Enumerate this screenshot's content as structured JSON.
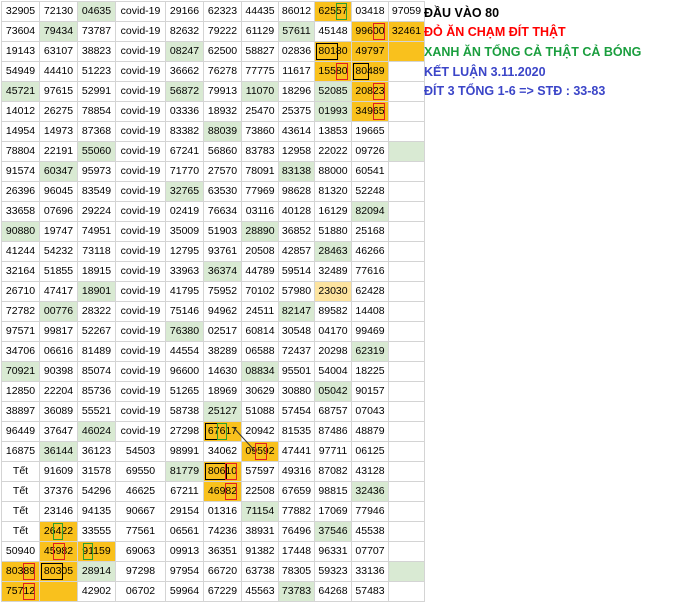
{
  "rows": [
    [
      "32905",
      "72130",
      "04635",
      "covid-19",
      "29166",
      "62323",
      "44435",
      "86012",
      "62557",
      "03418",
      "97059"
    ],
    [
      "73604",
      "79434",
      "73787",
      "covid-19",
      "82632",
      "79222",
      "61129",
      "57611",
      "45148",
      "99600",
      "32461"
    ],
    [
      "19143",
      "63107",
      "38823",
      "covid-19",
      "08247",
      "62500",
      "58827",
      "02836",
      "80180",
      "49797",
      ""
    ],
    [
      "54949",
      "44410",
      "51223",
      "covid-19",
      "36662",
      "76278",
      "77775",
      "11617",
      "15580",
      "80489",
      ""
    ],
    [
      "45721",
      "97615",
      "52991",
      "covid-19",
      "56872",
      "79913",
      "11070",
      "18296",
      "52085",
      "20823",
      ""
    ],
    [
      "14012",
      "26275",
      "78854",
      "covid-19",
      "03336",
      "18932",
      "25470",
      "25375",
      "01993",
      "34965",
      ""
    ],
    [
      "14954",
      "14973",
      "87368",
      "covid-19",
      "83382",
      "88039",
      "73860",
      "43614",
      "13853",
      "19665",
      ""
    ],
    [
      "78804",
      "22191",
      "55060",
      "covid-19",
      "67241",
      "56860",
      "83783",
      "12958",
      "22022",
      "09726",
      ""
    ],
    [
      "91574",
      "60347",
      "95973",
      "covid-19",
      "71770",
      "27570",
      "78091",
      "83138",
      "88000",
      "60541",
      ""
    ],
    [
      "26396",
      "96045",
      "83549",
      "covid-19",
      "32765",
      "63530",
      "77969",
      "98628",
      "81320",
      "52248",
      ""
    ],
    [
      "33658",
      "07696",
      "29224",
      "covid-19",
      "02419",
      "76634",
      "03116",
      "40128",
      "16129",
      "82094",
      ""
    ],
    [
      "90880",
      "19747",
      "74951",
      "covid-19",
      "35009",
      "51903",
      "28890",
      "36852",
      "51880",
      "25168",
      ""
    ],
    [
      "41244",
      "54232",
      "73118",
      "covid-19",
      "12795",
      "93761",
      "20508",
      "42857",
      "28463",
      "46266",
      ""
    ],
    [
      "32164",
      "51855",
      "18915",
      "covid-19",
      "33963",
      "36374",
      "44789",
      "59514",
      "32489",
      "77616",
      ""
    ],
    [
      "26710",
      "47417",
      "18901",
      "covid-19",
      "41795",
      "75952",
      "70102",
      "57980",
      "23030",
      "62428",
      ""
    ],
    [
      "72782",
      "00776",
      "28322",
      "covid-19",
      "75146",
      "94962",
      "24511",
      "82147",
      "89582",
      "14408",
      ""
    ],
    [
      "97571",
      "99817",
      "52267",
      "covid-19",
      "76380",
      "02517",
      "60814",
      "30548",
      "04170",
      "99469",
      ""
    ],
    [
      "34706",
      "06616",
      "81489",
      "covid-19",
      "44554",
      "38289",
      "06588",
      "72437",
      "20298",
      "62319",
      ""
    ],
    [
      "70921",
      "90398",
      "85074",
      "covid-19",
      "96600",
      "14630",
      "08834",
      "95501",
      "54004",
      "18225",
      ""
    ],
    [
      "12850",
      "22204",
      "85736",
      "covid-19",
      "51265",
      "18969",
      "30629",
      "30880",
      "05042",
      "90157",
      ""
    ],
    [
      "38897",
      "36089",
      "55521",
      "covid-19",
      "58738",
      "25127",
      "51088",
      "57454",
      "68757",
      "07043",
      ""
    ],
    [
      "96449",
      "37647",
      "46024",
      "covid-19",
      "27298",
      "67617",
      "20942",
      "81535",
      "87486",
      "48879",
      ""
    ],
    [
      "16875",
      "36144",
      "36123",
      "54503",
      "98991",
      "34062",
      "09592",
      "47441",
      "97711",
      "06125",
      ""
    ],
    [
      "Tết",
      "91609",
      "31578",
      "69550",
      "81779",
      "80610",
      "57597",
      "49316",
      "87082",
      "43128",
      ""
    ],
    [
      "Tết",
      "37376",
      "54296",
      "46625",
      "67211",
      "46982",
      "22508",
      "67659",
      "98815",
      "32436",
      ""
    ],
    [
      "Tết",
      "23146",
      "94135",
      "90667",
      "29154",
      "01316",
      "71154",
      "77882",
      "17069",
      "77946",
      ""
    ],
    [
      "Tết",
      "26422",
      "33555",
      "77561",
      "06561",
      "74236",
      "38931",
      "76496",
      "37546",
      "45538",
      ""
    ],
    [
      "50940",
      "45982",
      "91159",
      "69063",
      "09913",
      "36351",
      "91382",
      "17448",
      "96331",
      "07707",
      ""
    ],
    [
      "80389",
      "80305",
      "28914",
      "97298",
      "97954",
      "66720",
      "63738",
      "78305",
      "59323",
      "33136",
      ""
    ],
    [
      "75712",
      "",
      "42902",
      "06702",
      "59964",
      "67229",
      "45563",
      "73783",
      "64268",
      "57483",
      ""
    ]
  ],
  "legend": {
    "line1": "ĐẦU VÀO 80",
    "line2": "ĐỎ ĂN CHẠM ĐÍT THẬT",
    "line3": "XANH ĂN TỔNG CẢ THẬT CẢ BÓNG",
    "line4": "KẾT LUẬN 3.11.2020",
    "line5": "ĐÍT 3 TỔNG 1-6 => STĐ : 33-83"
  },
  "colors": {
    "green": "#d9ead3",
    "orange": "#f9c11d",
    "light_orange": "#fde4a0",
    "red": "#ff0000",
    "legend_green": "#1a9e3e",
    "legend_blue": "#3b45c8"
  }
}
